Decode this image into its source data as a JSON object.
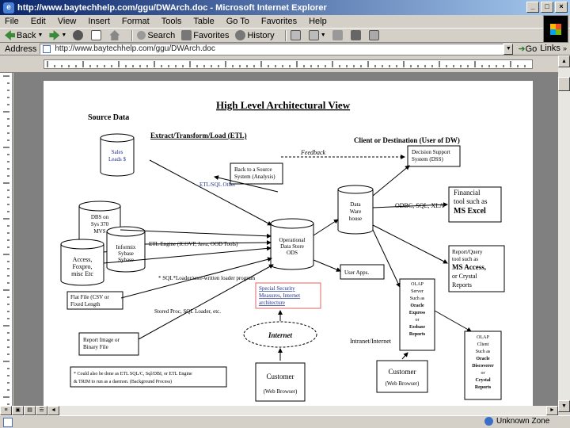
{
  "window": {
    "title": "http://www.baytechhelp.com/ggu/DWArch.doc - Microsoft Internet Explorer"
  },
  "menu": [
    "File",
    "Edit",
    "View",
    "Insert",
    "Format",
    "Tools",
    "Table",
    "Go To",
    "Favorites",
    "Help"
  ],
  "toolbar": {
    "back": "Back",
    "search": "Search",
    "favorites": "Favorites",
    "history": "History"
  },
  "address": {
    "label": "Address",
    "url": "http://www.baytechhelp.com/ggu/DWArch.doc",
    "go": "Go",
    "links": "Links"
  },
  "status": {
    "zone": "Unknown Zone"
  },
  "doc": {
    "title": "High Level Architectural View",
    "source_data": "Source Data",
    "etl_heading": "Extract/Transform/Load (ETL)",
    "client_heading": "Client or Destination (User of DW)",
    "feedback": "Feedback",
    "dss": [
      "Decision Support",
      "System (DSS)"
    ],
    "back_to_source": [
      "Back to a Source",
      "System (Analysis)"
    ],
    "etl_other": "ETL/SQL Other",
    "sales_leads": [
      "Sales",
      "Leads $"
    ],
    "dbs": [
      "DBS on",
      "Sys 370",
      "MVS"
    ],
    "informix": [
      "Informix",
      "Sybase",
      "Sybase"
    ],
    "access": [
      "Access,",
      "Foxpro,",
      "misc Etc"
    ],
    "etl_engine": "ETL Engine (ICOVP, Java, OOD Tools)",
    "ods": [
      "Operational",
      "Data Store",
      "ODS"
    ],
    "data_warehouse": [
      "Data",
      "Ware",
      "house"
    ],
    "odbc": "ODBC, SQL, XLA",
    "financial": [
      "Financial",
      "tool such as",
      "MS Excel"
    ],
    "report_query": [
      "Report/Query",
      "tool such as",
      "MS Access,",
      "or Crystal",
      "Reports"
    ],
    "user_apps": "User Apps.",
    "sql_note": "* SQL*Loader/user-written loader program",
    "flat_file": [
      "Flat File (CSV or",
      "Fixed Length"
    ],
    "stored_proc": "Stored Proc, SQL Loader, etc.",
    "special_security": [
      "Special Security",
      "Measures, Internet",
      "architecture"
    ],
    "olap_server": [
      "OLAP",
      "Server",
      "Such as",
      "Oracle",
      "Express",
      "or",
      "Essbase",
      "Reports"
    ],
    "olap_client": [
      "OLAP",
      "Client",
      "Such as",
      "Oracle",
      "Discoverer",
      "or",
      "Crystal",
      "Reports"
    ],
    "internet": "Internet",
    "intranet": "Intranet/Internet",
    "report_image": [
      "Report Image or",
      "Binary File"
    ],
    "footnote": [
      "* Could also be done as ETL SQL/C, Sql/DBI, or ETL Engine",
      "& TRIM to run as a daemon. (Background Process)"
    ],
    "customer_top": "Customer",
    "customer_sub": "(Web Browser)",
    "customer2": "Customer",
    "customer2_sub": "(Web Browser)"
  }
}
